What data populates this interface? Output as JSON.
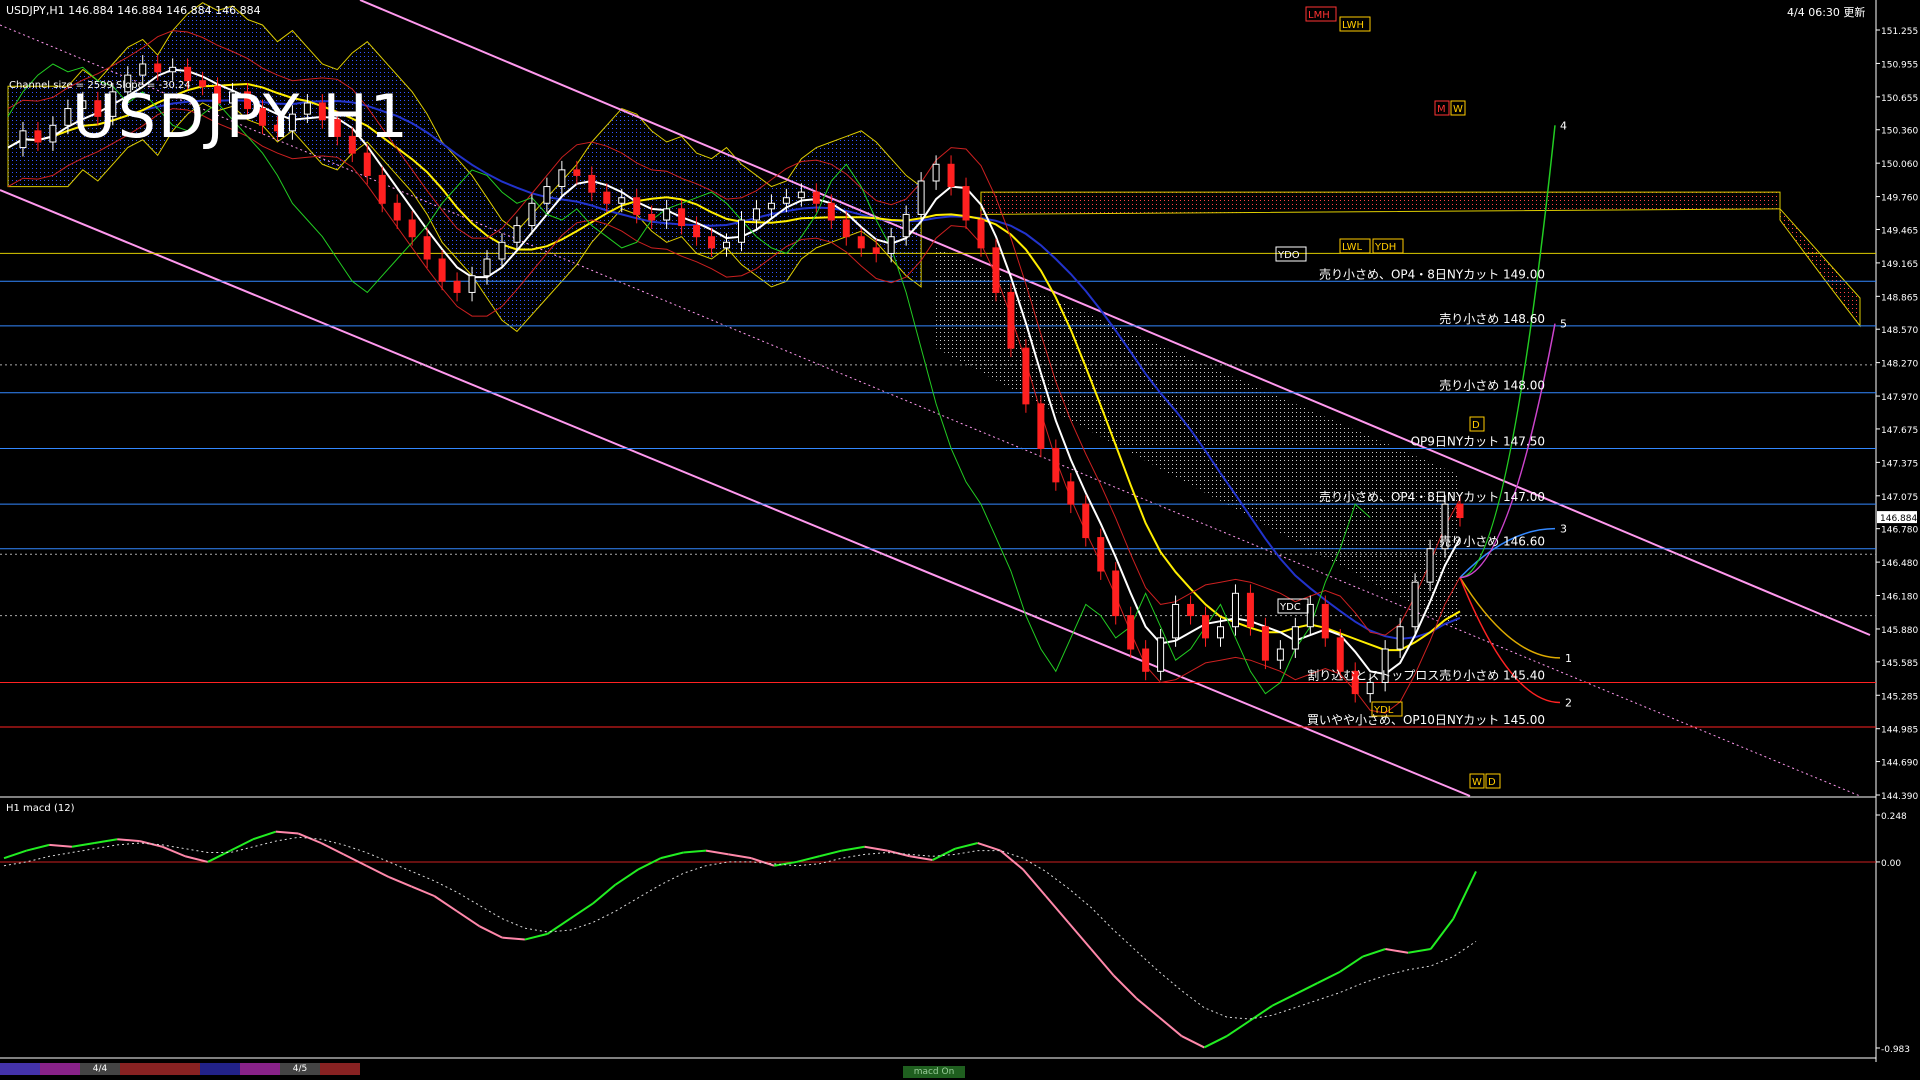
{
  "header": {
    "symbol_line": "USDJPY,H1",
    "ohlc": "146.884 146.884 146.884 146.884",
    "updated": "4/4 06:30 更新"
  },
  "chart_title": "USDJPY H1",
  "channel_info": "Channel size = 2599 Slope = -30.24",
  "colors": {
    "background": "#000000",
    "bull_candle": "#ffffff",
    "bear_candle": "#ff2020",
    "sma_white": "#ffffff",
    "sma_yellow": "#ffee00",
    "sma_blue": "#2233cc",
    "chikou_green": "#22cc22",
    "bollinger_red": "#cc2020",
    "channel_pink": "#ff99ee",
    "level_blue": "#3388ff",
    "level_red": "#ff2222",
    "macd_green": "#22ee22",
    "macd_pink": "#ff88aa"
  },
  "chart_data": [
    {
      "type": "candlestick",
      "title": "USDJPY H1",
      "ylim": [
        144.39,
        151.255
      ],
      "y_ticks": [
        "151.255",
        "150.955",
        "150.655",
        "150.360",
        "150.060",
        "149.760",
        "149.465",
        "149.165",
        "148.865",
        "148.570",
        "148.270",
        "147.970",
        "147.675",
        "147.375",
        "147.075",
        "146.780",
        "146.480",
        "146.180",
        "145.880",
        "145.585",
        "145.285",
        "144.985",
        "144.690",
        "144.390"
      ],
      "current_price": "146.884",
      "closes": [
        150.2,
        150.35,
        150.25,
        150.4,
        150.55,
        150.62,
        150.48,
        150.7,
        150.85,
        150.95,
        150.88,
        150.92,
        150.8,
        150.75,
        150.6,
        150.7,
        150.55,
        150.4,
        150.35,
        150.5,
        150.6,
        150.45,
        150.3,
        150.15,
        149.95,
        149.7,
        149.55,
        149.4,
        149.2,
        149.0,
        148.9,
        149.05,
        149.2,
        149.35,
        149.5,
        149.7,
        149.85,
        150.0,
        149.95,
        149.8,
        149.7,
        149.75,
        149.6,
        149.55,
        149.65,
        149.5,
        149.4,
        149.3,
        149.35,
        149.55,
        149.65,
        149.7,
        149.75,
        149.8,
        149.7,
        149.55,
        149.4,
        149.3,
        149.25,
        149.4,
        149.6,
        149.9,
        150.05,
        149.85,
        149.55,
        149.3,
        148.9,
        148.4,
        147.9,
        147.5,
        147.2,
        147.0,
        146.7,
        146.4,
        146.0,
        145.7,
        145.5,
        145.8,
        146.1,
        146.0,
        145.8,
        145.9,
        146.2,
        145.9,
        145.6,
        145.7,
        145.9,
        146.1,
        145.8,
        145.5,
        145.3,
        145.4,
        145.7,
        145.9,
        146.3,
        146.6,
        147.0,
        146.88
      ],
      "levels": [
        {
          "label": "売り小さめ、OP4・8日NYカット 149.00",
          "value": 149.0,
          "color": "#3388ff"
        },
        {
          "label": "売り小さめ 148.60",
          "value": 148.6,
          "color": "#3388ff"
        },
        {
          "label": "売り小さめ 148.00",
          "value": 148.0,
          "color": "#3388ff"
        },
        {
          "label": "OP9日NYカット 147.50",
          "value": 147.5,
          "color": "#3388ff"
        },
        {
          "label": "売り小さめ、OP4・8日NYカット 147.00",
          "value": 147.0,
          "color": "#3388ff"
        },
        {
          "label": "売り小さめ 146.60",
          "value": 146.6,
          "color": "#3388ff"
        },
        {
          "label": "割り込むとストップロス売り小さめ 145.40",
          "value": 145.4,
          "color": "#ff2222"
        },
        {
          "label": "買いやや小さめ、OP10日NYカット 145.00",
          "value": 145.0,
          "color": "#ff2222"
        }
      ],
      "markers": [
        "LMH",
        "LWH",
        "M",
        "W",
        "YDO",
        "LWL",
        "YDH",
        "YDC",
        "YDL",
        "D",
        "W",
        "D"
      ],
      "projections": [
        "1",
        "2",
        "3",
        "4",
        "5"
      ]
    },
    {
      "type": "line",
      "title": "H1  macd (12)",
      "ylim": [
        -0.983,
        0.248
      ],
      "y_ticks": [
        "0.248",
        "0.00",
        "-0.983"
      ],
      "series": [
        {
          "values": [
            0.02,
            0.06,
            0.09,
            0.08,
            0.1,
            0.12,
            0.11,
            0.08,
            0.03,
            0.0,
            0.06,
            0.12,
            0.16,
            0.15,
            0.1,
            0.04,
            -0.02,
            -0.08,
            -0.13,
            -0.18,
            -0.26,
            -0.34,
            -0.4,
            -0.41,
            -0.38,
            -0.3,
            -0.22,
            -0.12,
            -0.04,
            0.02,
            0.05,
            0.06,
            0.04,
            0.02,
            -0.02,
            0.0,
            0.03,
            0.06,
            0.08,
            0.06,
            0.03,
            0.01,
            0.07,
            0.1,
            0.06,
            -0.04,
            -0.18,
            -0.32,
            -0.46,
            -0.6,
            -0.72,
            -0.82,
            -0.92,
            -0.98,
            -0.92,
            -0.84,
            -0.76,
            -0.7,
            -0.64,
            -0.58,
            -0.5,
            -0.46,
            -0.48,
            -0.46,
            -0.3,
            -0.05
          ]
        },
        {
          "values": [
            -0.02,
            0.0,
            0.03,
            0.05,
            0.07,
            0.09,
            0.1,
            0.09,
            0.07,
            0.05,
            0.05,
            0.08,
            0.11,
            0.13,
            0.12,
            0.09,
            0.05,
            0.0,
            -0.05,
            -0.1,
            -0.16,
            -0.23,
            -0.3,
            -0.35,
            -0.37,
            -0.36,
            -0.32,
            -0.26,
            -0.19,
            -0.12,
            -0.06,
            -0.02,
            0.0,
            0.0,
            -0.01,
            -0.02,
            -0.01,
            0.02,
            0.04,
            0.05,
            0.04,
            0.03,
            0.04,
            0.06,
            0.06,
            0.02,
            -0.05,
            -0.14,
            -0.24,
            -0.36,
            -0.47,
            -0.58,
            -0.68,
            -0.77,
            -0.82,
            -0.83,
            -0.81,
            -0.77,
            -0.73,
            -0.69,
            -0.64,
            -0.6,
            -0.57,
            -0.55,
            -0.5,
            -0.42
          ]
        }
      ]
    }
  ],
  "time_tabs": [
    "",
    "",
    "4/4",
    "",
    "",
    "",
    "",
    "4/5",
    ""
  ],
  "macd_tab": "macd On"
}
